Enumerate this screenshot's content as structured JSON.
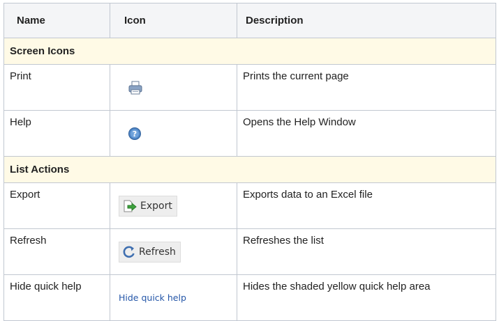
{
  "headers": {
    "name": "Name",
    "icon": "Icon",
    "description": "Description"
  },
  "sections": [
    {
      "title": "Screen Icons",
      "rows": [
        {
          "name": "Print",
          "icon": "printer-icon",
          "description": "Prints the current page"
        },
        {
          "name": "Help",
          "icon": "help-icon",
          "description": "Opens the Help Window"
        }
      ]
    },
    {
      "title": "List Actions",
      "rows": [
        {
          "name": "Export",
          "icon": "export-icon",
          "icon_label": "Export",
          "description": "Exports data to an Excel file"
        },
        {
          "name": "Refresh",
          "icon": "refresh-icon",
          "icon_label": "Refresh",
          "description": "Refreshes the list"
        },
        {
          "name": "Hide quick help",
          "icon_label": "Hide quick help",
          "description": "Hides the shaded yellow quick help area"
        }
      ]
    }
  ],
  "colors": {
    "header_bg": "#f4f5f7",
    "section_bg": "#fffae6",
    "border": "#c1c7d0",
    "link": "#2456a8"
  }
}
